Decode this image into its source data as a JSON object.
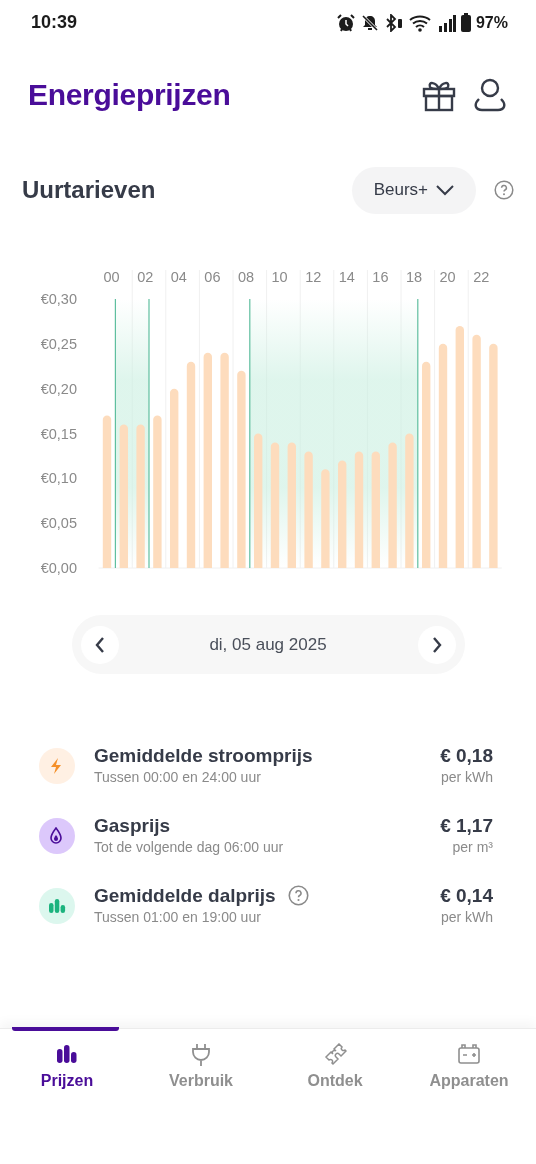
{
  "status_bar": {
    "time": "10:39",
    "battery": "97%"
  },
  "header": {
    "title": "Energieprijzen"
  },
  "section": {
    "title": "Uurtarieven",
    "dropdown": "Beurs+"
  },
  "chart": {
    "chart_data": {
      "type": "bar",
      "x": [
        0,
        1,
        2,
        3,
        4,
        5,
        6,
        7,
        8,
        9,
        10,
        11,
        12,
        13,
        14,
        15,
        16,
        17,
        18,
        19,
        20,
        21,
        22,
        23
      ],
      "values": [
        0.17,
        0.16,
        0.16,
        0.17,
        0.2,
        0.23,
        0.24,
        0.24,
        0.22,
        0.15,
        0.14,
        0.14,
        0.13,
        0.11,
        0.12,
        0.13,
        0.13,
        0.14,
        0.15,
        0.23,
        0.25,
        0.27,
        0.26,
        0.25
      ],
      "ylim": [
        0,
        0.3
      ],
      "yticks": [
        {
          "value": 0,
          "label": "€0,00"
        },
        {
          "value": 0.05,
          "label": "€0,05"
        },
        {
          "value": 0.1,
          "label": "€0,10"
        },
        {
          "value": 0.15,
          "label": "€0,15"
        },
        {
          "value": 0.2,
          "label": "€0,20"
        },
        {
          "value": 0.25,
          "label": "€0,25"
        },
        {
          "value": 0.3,
          "label": "€0,30"
        }
      ],
      "xticks": [
        {
          "value": 0,
          "label": "00"
        },
        {
          "value": 2,
          "label": "02"
        },
        {
          "value": 4,
          "label": "04"
        },
        {
          "value": 6,
          "label": "06"
        },
        {
          "value": 8,
          "label": "08"
        },
        {
          "value": 10,
          "label": "10"
        },
        {
          "value": 12,
          "label": "12"
        },
        {
          "value": 14,
          "label": "14"
        },
        {
          "value": 16,
          "label": "16"
        },
        {
          "value": 18,
          "label": "18"
        },
        {
          "value": 20,
          "label": "20"
        },
        {
          "value": 22,
          "label": "22"
        }
      ],
      "xlim": [
        -0.5,
        23.5
      ],
      "grid": true,
      "bands": [
        {
          "axis": "x",
          "from": 0.5,
          "to": 2.5
        },
        {
          "axis": "x",
          "from": 8.5,
          "to": 18.5
        }
      ],
      "ref_lines": [
        {
          "axis": "x",
          "value": 0.5
        },
        {
          "axis": "x",
          "value": 2.5
        },
        {
          "axis": "x",
          "value": 8.5
        },
        {
          "axis": "x",
          "value": 18.5
        }
      ]
    }
  },
  "date_nav": {
    "date": "di, 05 aug 2025"
  },
  "prices": [
    {
      "kind": "power",
      "title": "Gemiddelde stroomprijs",
      "subtitle": "Tussen 00:00 en 24:00 uur",
      "price": "€ 0,18",
      "unit": "per kWh",
      "info": false
    },
    {
      "kind": "gas",
      "title": "Gasprijs",
      "subtitle": "Tot de volgende dag 06:00 uur",
      "price": "€ 1,17",
      "unit": "per m³",
      "info": false
    },
    {
      "kind": "offpeak",
      "title": "Gemiddelde dalprijs",
      "subtitle": "Tussen 01:00 en 19:00 uur",
      "price": "€ 0,14",
      "unit": "per kWh",
      "info": true
    }
  ],
  "tabs": [
    {
      "kind": "prices",
      "label": "Prijzen",
      "selected": true
    },
    {
      "kind": "usage",
      "label": "Verbruik",
      "selected": false
    },
    {
      "kind": "discover",
      "label": "Ontdek",
      "selected": false
    },
    {
      "kind": "devices",
      "label": "Apparaten",
      "selected": false
    }
  ]
}
